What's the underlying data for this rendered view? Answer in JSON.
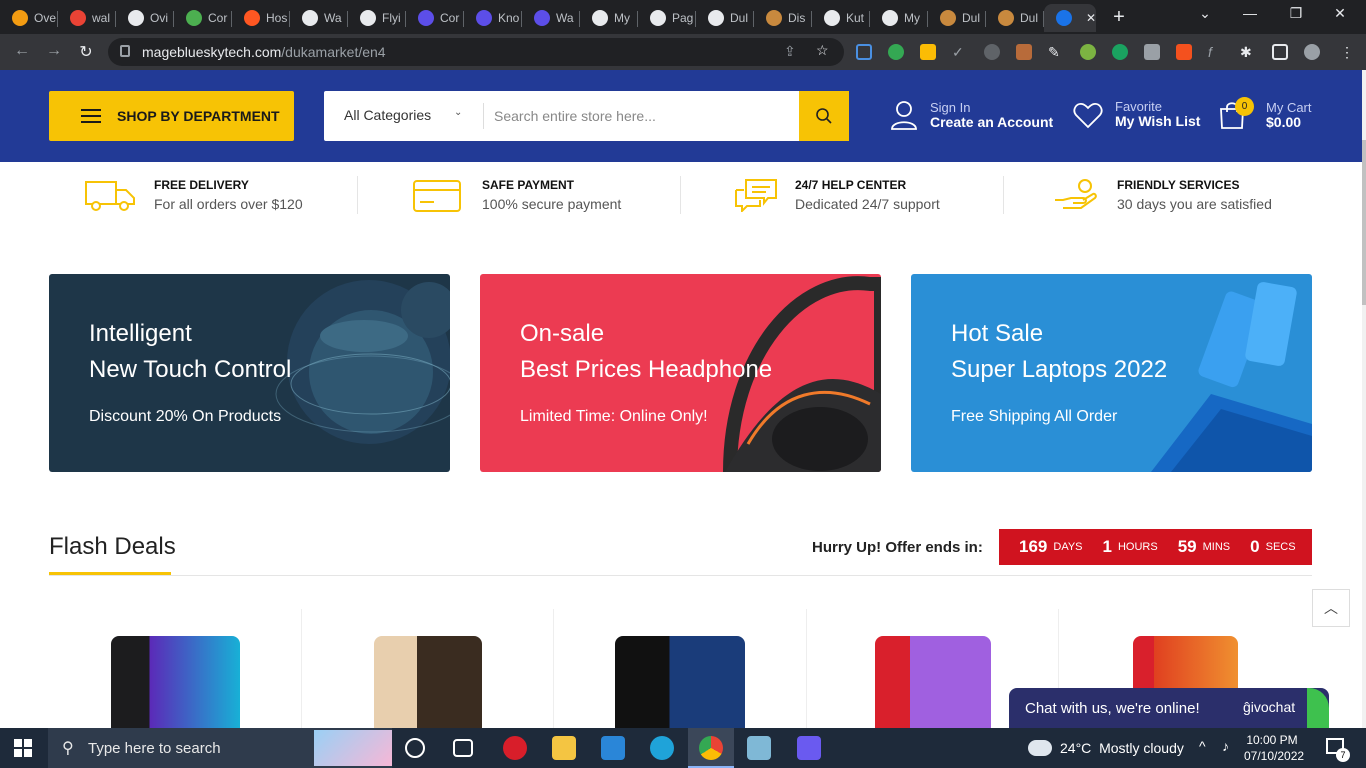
{
  "browser": {
    "tabs": [
      {
        "label": "Ove",
        "color": "#f39c12"
      },
      {
        "label": "wal",
        "color": "#ea4335"
      },
      {
        "label": "Ovi",
        "color": "#e8eaed"
      },
      {
        "label": "Cor",
        "color": "#4caf50"
      },
      {
        "label": "Hos",
        "color": "#ff5722"
      },
      {
        "label": "Wa",
        "color": "#e8eaed"
      },
      {
        "label": "Flyi",
        "color": "#e8eaed"
      },
      {
        "label": "Cor",
        "color": "#5c4ee8"
      },
      {
        "label": "Kno",
        "color": "#5c4ee8"
      },
      {
        "label": "Wa",
        "color": "#5c4ee8"
      },
      {
        "label": "My",
        "color": "#e8eaed"
      },
      {
        "label": "Pag",
        "color": "#e8eaed"
      },
      {
        "label": "Dul",
        "color": "#e8eaed"
      },
      {
        "label": "Dis",
        "color": "#c8893e"
      },
      {
        "label": "Kut",
        "color": "#e8eaed"
      },
      {
        "label": "My",
        "color": "#e8eaed"
      },
      {
        "label": "Dul",
        "color": "#c8893e"
      },
      {
        "label": "Dul",
        "color": "#c8893e"
      }
    ],
    "url_host": "mageblueskytech.com",
    "url_path": "/dukamarket/en4"
  },
  "header": {
    "dept_label": "SHOP BY DEPARTMENT",
    "category_select": "All Categories",
    "search_placeholder": "Search entire store here...",
    "signin_small": "Sign In",
    "signin_big": "Create an Account",
    "wish_small": "Favorite",
    "wish_big": "My Wish List",
    "cart_small": "My Cart",
    "cart_big": "$0.00",
    "cart_count": "0",
    "accent": "#f7c305",
    "bg": "#223a96"
  },
  "services": [
    {
      "title": "FREE DELIVERY",
      "desc": "For all orders over $120",
      "icon": "truck-icon"
    },
    {
      "title": "SAFE PAYMENT",
      "desc": "100% secure payment",
      "icon": "credit-card-icon"
    },
    {
      "title": "24/7 HELP CENTER",
      "desc": "Dedicated 24/7 support",
      "icon": "chat-bubbles-icon"
    },
    {
      "title": "FRIENDLY SERVICES",
      "desc": "30 days you are satisfied",
      "icon": "hand-coin-icon"
    }
  ],
  "banners": [
    {
      "l1": "Intelligent",
      "l2": "New Touch Control",
      "l3": "Discount 20% On Products",
      "bg": "#1e3648"
    },
    {
      "l1": "On-sale",
      "l2": "Best Prices Headphone",
      "l3": "Limited Time: Online Only!",
      "bg": "#ec3b52"
    },
    {
      "l1": "Hot Sale",
      "l2": "Super Laptops 2022",
      "l3": "Free Shipping All Order",
      "bg": "#2a8fd6"
    }
  ],
  "flash": {
    "title": "Flash Deals",
    "hurry": "Hurry Up! Offer ends in:",
    "days": "169",
    "days_unit": "DAYS",
    "hours": "1",
    "hours_unit": "HOURS",
    "mins": "59",
    "mins_unit": "MINS",
    "secs": "0",
    "secs_unit": "SECS"
  },
  "chat": {
    "text": "Chat with us, we're online!",
    "brand": "ĝivochat"
  },
  "taskbar": {
    "search_placeholder": "Type here to search",
    "temp": "24°C",
    "weather": "Mostly cloudy",
    "time": "10:00 PM",
    "date": "07/10/2022",
    "notifications": "7"
  }
}
